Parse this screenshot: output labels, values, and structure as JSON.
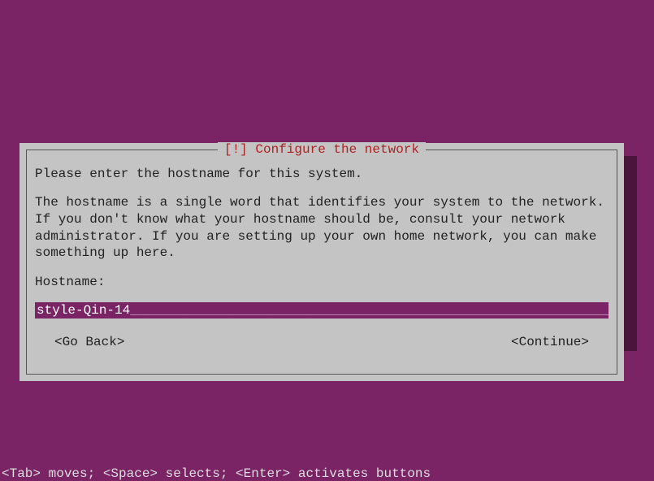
{
  "dialog": {
    "title": "[!] Configure the network",
    "prompt": "Please enter the hostname for this system.",
    "help": "The hostname is a single word that identifies your system to the network. If you don't know what your hostname should be, consult your network administrator. If you are setting up your own home network, you can make something up here.",
    "field_label": "Hostname:",
    "input_value": "style-Qin-14",
    "go_back": "<Go Back>",
    "continue": "<Continue>"
  },
  "footer": {
    "help": "<Tab> moves; <Space> selects; <Enter> activates buttons"
  }
}
